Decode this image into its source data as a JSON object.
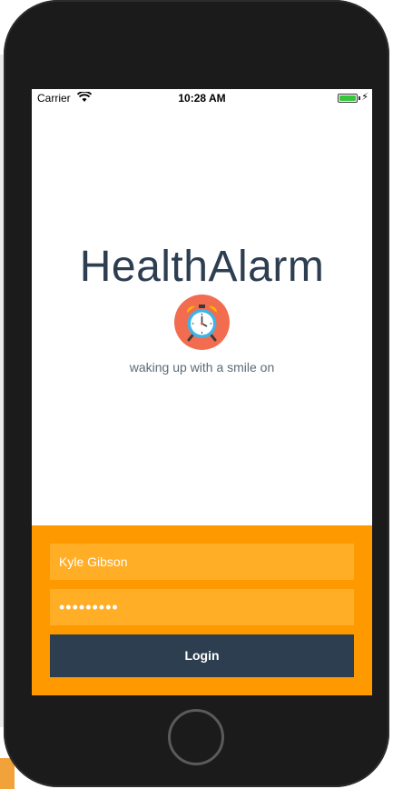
{
  "status_bar": {
    "carrier": "Carrier",
    "time": "10:28 AM",
    "battery_color": "#35c63c"
  },
  "app": {
    "title": "HealthAlarm",
    "tagline": "waking up with a smile on",
    "logo_icon": "alarm-clock-icon",
    "logo_bg": "#f26c4f",
    "title_color": "#2c3e50"
  },
  "login": {
    "username_value": "Kyle Gibson",
    "password_value": "•••••••••",
    "button_label": "Login",
    "panel_color": "#ff9900",
    "field_color": "#ffae26",
    "button_color": "#2c3e50"
  }
}
